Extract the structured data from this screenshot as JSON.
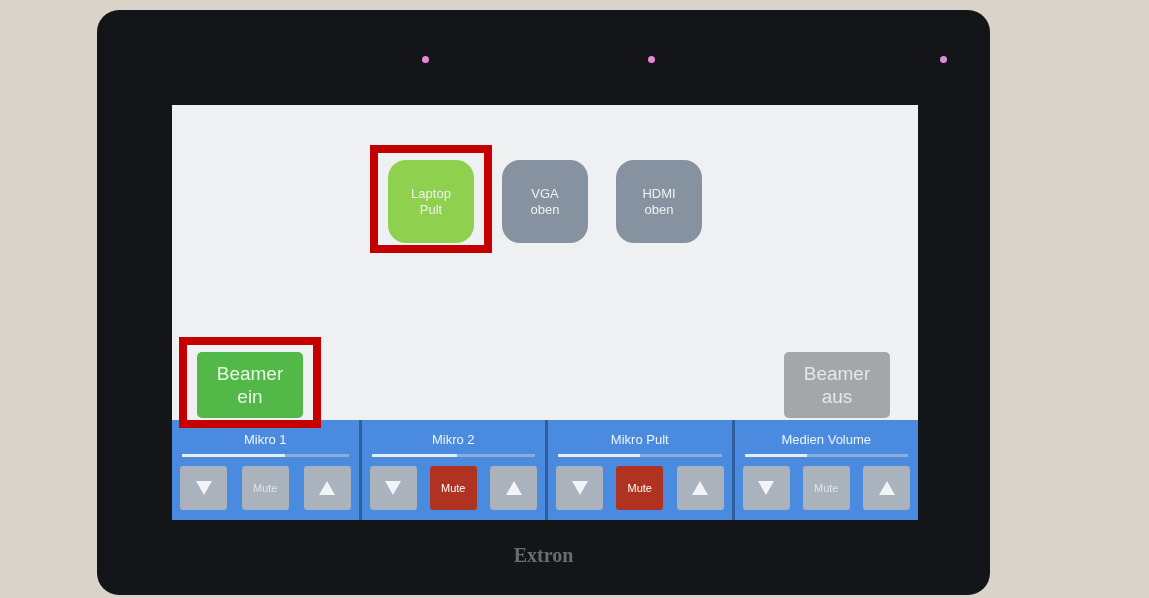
{
  "bezel": {
    "logo": "Extron"
  },
  "sources": [
    {
      "label": "Laptop Pult",
      "selected": true,
      "highlighted": true
    },
    {
      "label": "VGA oben",
      "selected": false,
      "highlighted": false
    },
    {
      "label": "HDMI oben",
      "selected": false,
      "highlighted": false
    }
  ],
  "power": [
    {
      "label": "Beamer ein",
      "active": true,
      "highlighted": true
    },
    {
      "label": "Beamer aus",
      "active": false,
      "highlighted": false
    }
  ],
  "channels": [
    {
      "name": "Mikro 1",
      "level": 0.62,
      "mute_label": "Mute",
      "muted": false
    },
    {
      "name": "Mikro 2",
      "level": 0.52,
      "mute_label": "Mute",
      "muted": true
    },
    {
      "name": "Mikro Pult",
      "level": 0.5,
      "mute_label": "Mute",
      "muted": true
    },
    {
      "name": "Medien Volume",
      "level": 0.38,
      "mute_label": "Mute",
      "muted": false
    }
  ]
}
